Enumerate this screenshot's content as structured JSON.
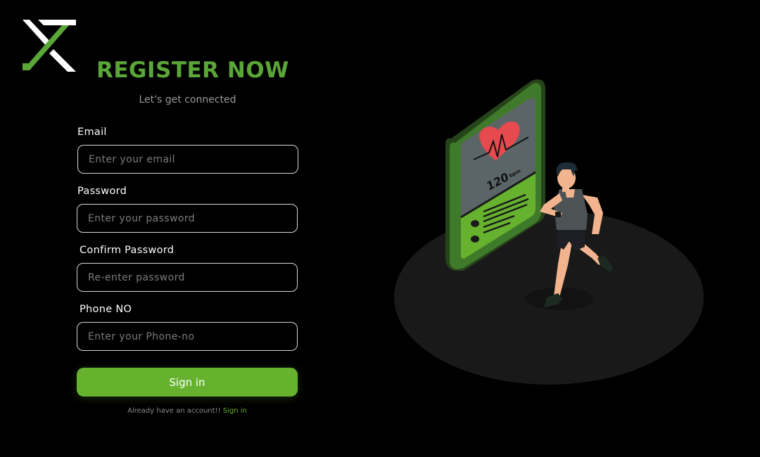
{
  "header": {
    "title": "REGISTER NOW",
    "subtitle": "Let's get connected"
  },
  "form": {
    "email": {
      "label": "Email",
      "placeholder": "Enter your email",
      "value": ""
    },
    "password": {
      "label": "Password",
      "placeholder": "Enter your password",
      "value": ""
    },
    "confirm_password": {
      "label": "Confirm Password",
      "placeholder": "Re-enter password",
      "value": ""
    },
    "phone": {
      "label": "Phone NO",
      "placeholder": "Enter your Phone-no",
      "value": ""
    },
    "submit_label": "Sign in"
  },
  "footer": {
    "text": "Already  have an account!! ",
    "link": "Sign in"
  },
  "illustration": {
    "heart_rate": "120",
    "heart_rate_unit": "bpm"
  },
  "colors": {
    "accent": "#66b22f",
    "title": "#5aa637",
    "background": "#000000"
  },
  "icons": {
    "logo": "brand-logo-icon"
  }
}
